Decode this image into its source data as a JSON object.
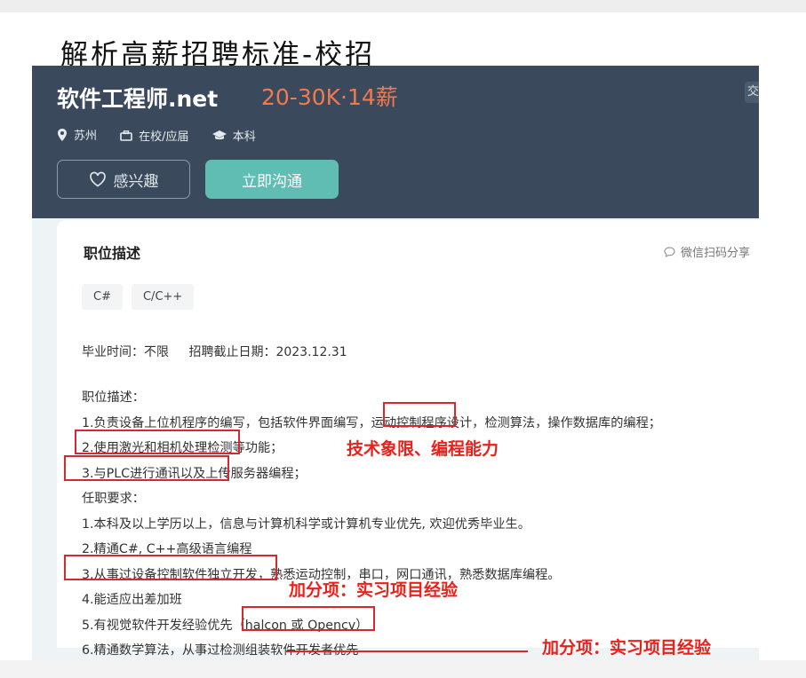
{
  "slide": {
    "title": "解析高薪招聘标准-校招"
  },
  "job": {
    "title": "软件工程师.net",
    "salary": "20-30K·14薪",
    "cut_text": "交",
    "meta": {
      "city": "苏州",
      "stage": "在校/应届",
      "degree": "本科"
    },
    "buttons": {
      "interest": "感兴趣",
      "chat": "立即沟通"
    }
  },
  "card": {
    "title": "职位描述",
    "share": "微信扫码分享",
    "tags": [
      "C#",
      "C/C++"
    ],
    "graduation": "毕业时间：不限",
    "deadline": "招聘截止日期：2023.12.31",
    "lines": [
      "职位描述：",
      "1.负责设备上位机程序的编写，包括软件界面编写，运动控制程序设计，检测算法，操作数据库的编程；",
      "2.使用激光和相机处理检测等功能；",
      "3.与PLC进行通讯以及上传服务器编程；",
      "任职要求：",
      "1.本科及以上学历以上，信息与计算机科学或计算机专业优先, 欢迎优秀毕业生。",
      "2.精通C#, C++高级语言编程",
      "3.从事过设备控制软件独立开发，熟悉运动控制，串口，网口通讯，熟悉数据库编程。",
      "4.能适应出差加班",
      "5.有视觉软件开发经验优先（halcon 或 Opencv）",
      "6.精通数学算法，从事过检测组装软件开发者优先"
    ]
  },
  "annotations": {
    "tech_note": "技术象限、编程能力",
    "bonus_note_1": "加分项：实习项目经验",
    "bonus_note_2": "加分项：实习项目经验",
    "color": "#e8221b"
  },
  "colors": {
    "header_bg": "#3a4a5c",
    "salary": "#f07a4e",
    "chat_button": "#5fbdb4"
  }
}
